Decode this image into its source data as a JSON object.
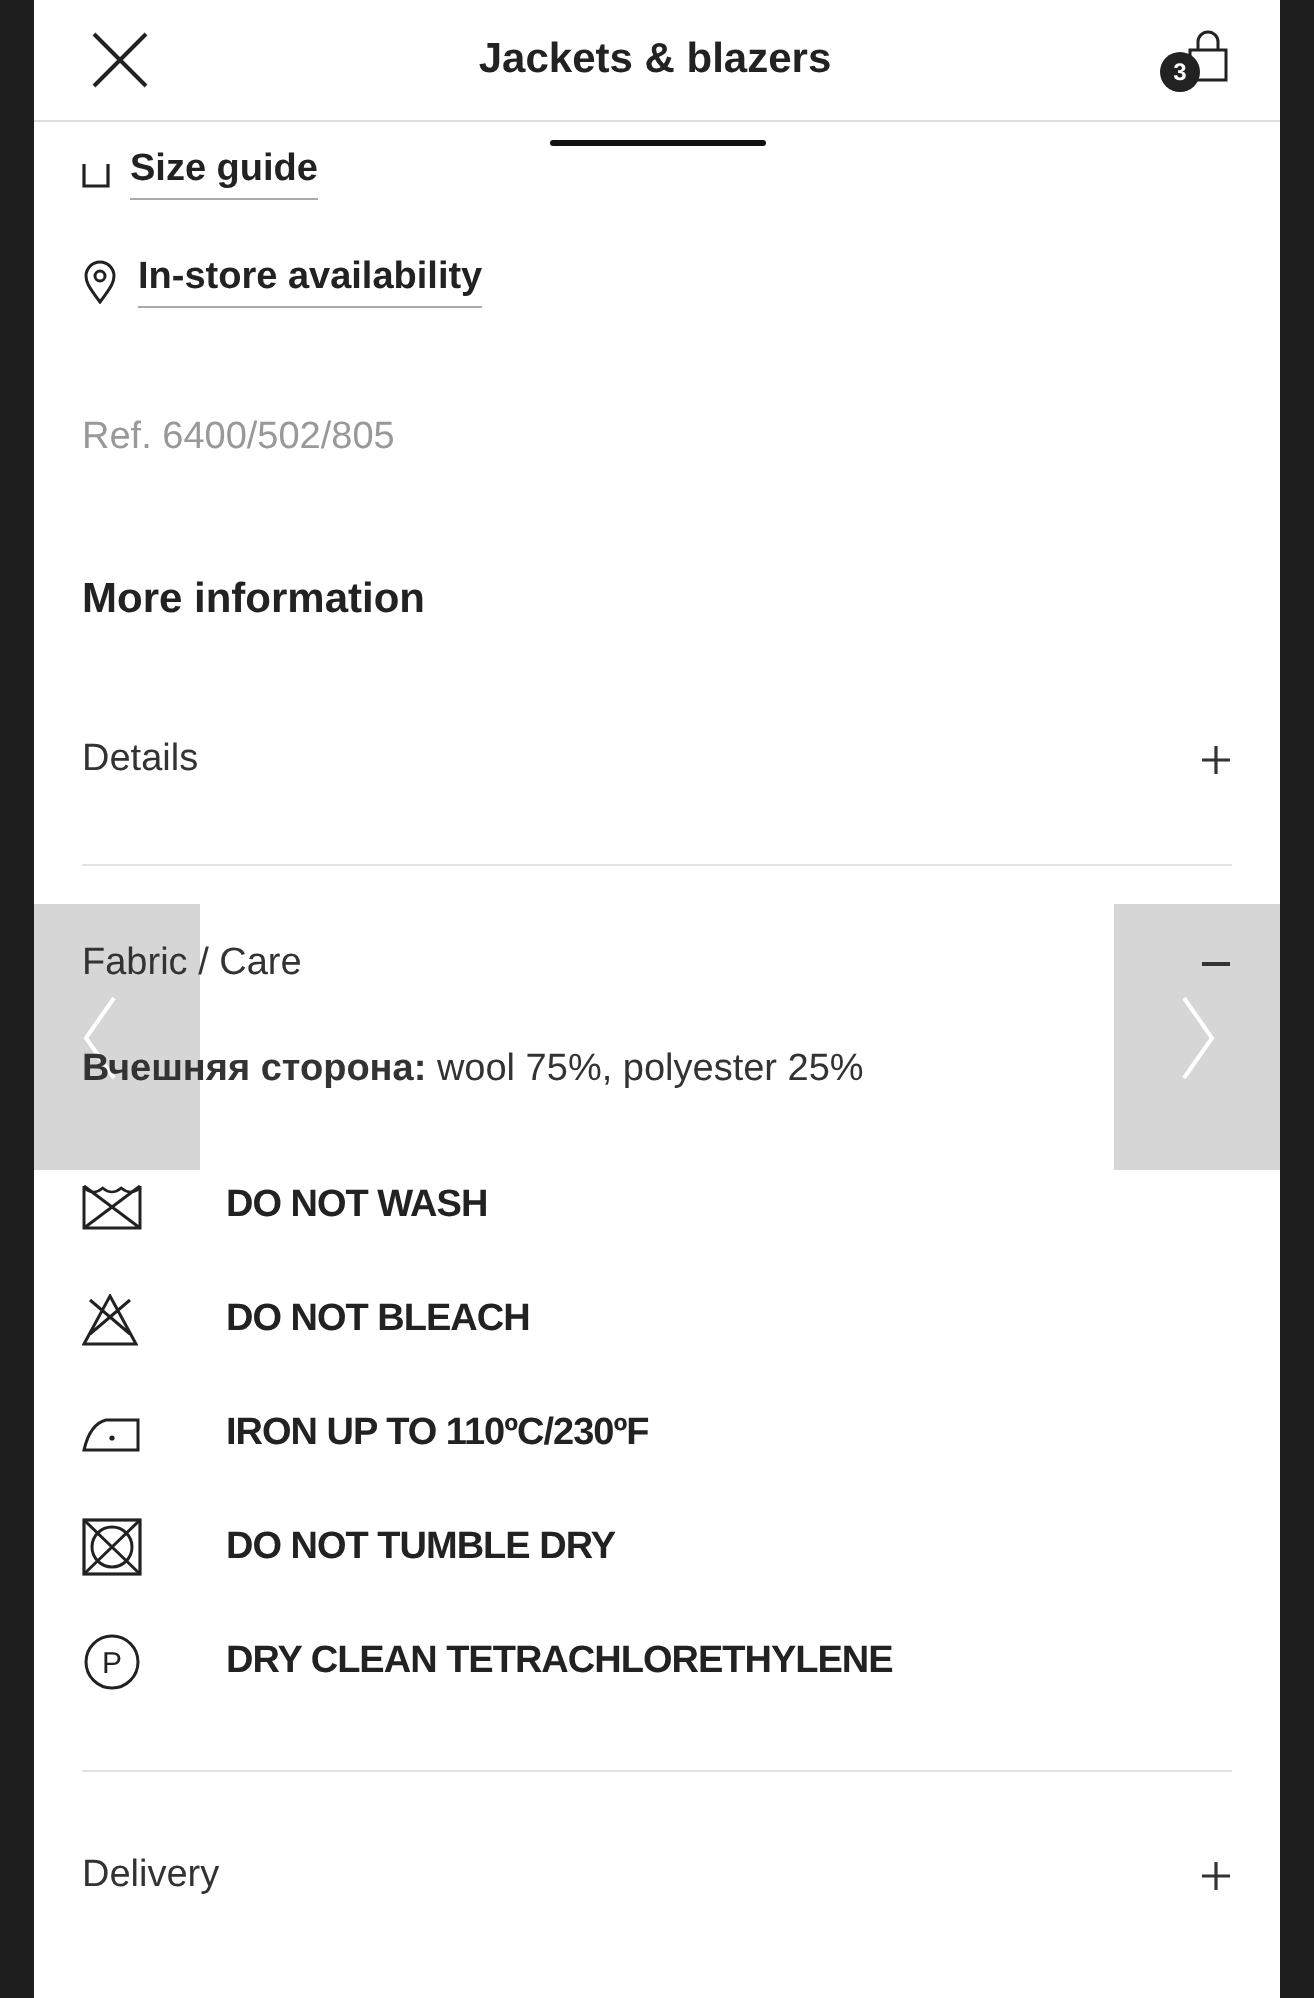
{
  "header": {
    "title": "Jackets & blazers",
    "cart_count": "3"
  },
  "links": [
    {
      "kind": "size",
      "label": "Size guide"
    },
    {
      "kind": "store",
      "label": "In-store availability"
    }
  ],
  "reference": "Ref. 6400/502/805",
  "more_information": {
    "title": "More information",
    "sections": [
      {
        "label": "Details",
        "expanded": false
      },
      {
        "label": "Fabric / Care",
        "expanded": true,
        "composition": "**Вчешняя сторона:** wool 75%, polyester 25%",
        "care": [
          {
            "kind": "wash",
            "label": "DO NOT WASH"
          },
          {
            "kind": "bleach",
            "label": "DO NOT BLEACH"
          },
          {
            "kind": "iron",
            "label": "IRON UP TO 110ºC/230ºF"
          },
          {
            "kind": "tumble",
            "label": "DO NOT TUMBLE DRY"
          },
          {
            "kind": "dryclean",
            "symbol": "P",
            "label": "DRY CLEAN TETRACHLORETHYLENE"
          }
        ]
      },
      {
        "label": "Delivery",
        "expanded": false
      }
    ]
  }
}
